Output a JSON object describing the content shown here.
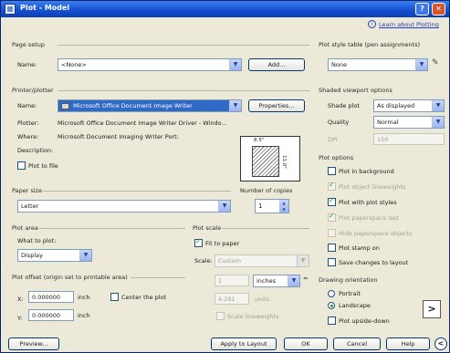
{
  "window": {
    "title": "Plot - Model",
    "help_glyph": "?",
    "close_glyph": "✕"
  },
  "learn_link": "Learn about Plotting",
  "info_glyph": "i",
  "page_setup": {
    "group": "Page setup",
    "name_label": "Name:",
    "name_value": "<None>",
    "add_button": "Add..."
  },
  "printer": {
    "group": "Printer/plotter",
    "name_label": "Name:",
    "name_value": "Microsoft Office Document Image Writer",
    "properties_button": "Properties...",
    "plotter_label": "Plotter:",
    "plotter_value": "Microsoft Office Document Image Writer Driver - Windo...",
    "where_label": "Where:",
    "where_value": "Microsoft Document Imaging Writer Port:",
    "description_label": "Description:",
    "plot_to_file": "Plot to file",
    "preview_width": "8.5\"",
    "preview_height": "11.0\""
  },
  "paper_size": {
    "group": "Paper size",
    "value": "Letter"
  },
  "copies": {
    "group": "Number of copies",
    "value": "1"
  },
  "plot_area": {
    "group": "Plot area",
    "what_label": "What to plot:",
    "value": "Display"
  },
  "plot_scale": {
    "group": "Plot scale",
    "fit_to_paper": "Fit to paper",
    "scale_label": "Scale:",
    "scale_value": "Custom",
    "num_value": "1",
    "unit_value": "inches",
    "eq_glyph": "=",
    "den_value": "4.281",
    "den_unit": "units",
    "scale_lineweights": "Scale lineweights"
  },
  "plot_offset": {
    "group": "Plot offset (origin set to printable area)",
    "x_label": "X:",
    "x_value": "0.000000",
    "x_unit": "inch",
    "y_label": "Y:",
    "y_value": "0.000000",
    "y_unit": "inch",
    "center_plot": "Center the plot"
  },
  "style_table": {
    "group": "Plot style table (pen assignments)",
    "value": "None"
  },
  "shaded": {
    "group": "Shaded viewport options",
    "shade_label": "Shade plot",
    "shade_value": "As displayed",
    "quality_label": "Quality",
    "quality_value": "Normal",
    "dpi_label": "DPI",
    "dpi_value": "150"
  },
  "plot_options": {
    "group": "Plot options",
    "items": [
      {
        "label": "Plot in background",
        "checked": false,
        "enabled": true
      },
      {
        "label": "Plot object lineweights",
        "checked": true,
        "enabled": false
      },
      {
        "label": "Plot with plot styles",
        "checked": true,
        "enabled": true
      },
      {
        "label": "Plot paperspace last",
        "checked": true,
        "enabled": false
      },
      {
        "label": "Hide paperspace objects",
        "checked": false,
        "enabled": false
      },
      {
        "label": "Plot stamp on",
        "checked": false,
        "enabled": true
      },
      {
        "label": "Save changes to layout",
        "checked": false,
        "enabled": true
      }
    ]
  },
  "orientation": {
    "group": "Drawing orientation",
    "portrait": "Portrait",
    "landscape": "Landscape",
    "upside_down": "Plot upside-down",
    "arrow_glyph": ">"
  },
  "footer": {
    "preview": "Preview...",
    "apply": "Apply to Layout",
    "ok": "OK",
    "cancel": "Cancel",
    "help": "Help",
    "collapse_glyph": "<"
  }
}
